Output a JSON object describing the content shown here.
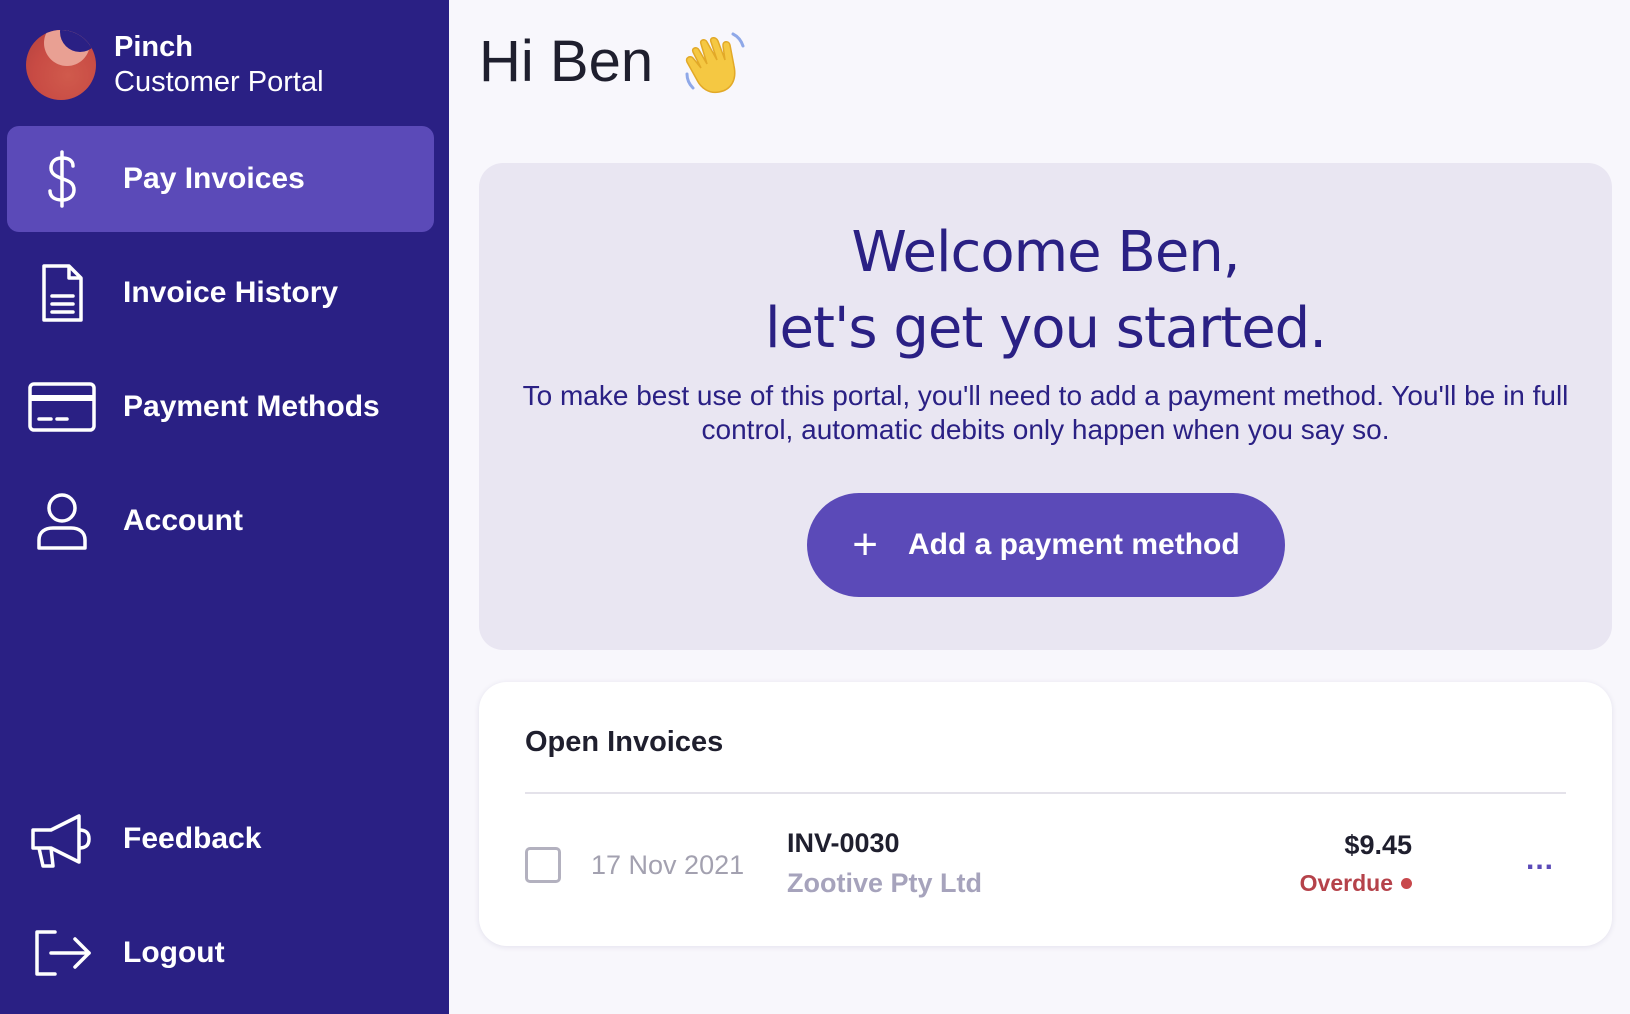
{
  "brand": {
    "name": "Pinch",
    "subtitle": "Customer Portal"
  },
  "sidebar": {
    "items": [
      {
        "label": "Pay Invoices",
        "icon": "dollar-icon",
        "active": true
      },
      {
        "label": "Invoice History",
        "icon": "document-icon",
        "active": false
      },
      {
        "label": "Payment Methods",
        "icon": "credit-card-icon",
        "active": false
      },
      {
        "label": "Account",
        "icon": "user-icon",
        "active": false
      }
    ],
    "bottom_items": [
      {
        "label": "Feedback",
        "icon": "megaphone-icon"
      },
      {
        "label": "Logout",
        "icon": "logout-icon"
      }
    ]
  },
  "main": {
    "greeting": "Hi Ben",
    "greeting_icon": "waving-hand-icon",
    "welcome": {
      "title_line1": "Welcome Ben,",
      "title_line2": "let's get you started.",
      "body": "To make best use of this portal, you'll need to add a payment method. You'll be in full control, automatic debits only happen when you say so.",
      "button_icon": "plus-icon",
      "button_label": "Add a payment method"
    },
    "open_invoices": {
      "title": "Open Invoices",
      "rows": [
        {
          "date": "17 Nov 2021",
          "number": "INV-0030",
          "company": "Zootive Pty Ltd",
          "amount": "$9.45",
          "status": "Overdue"
        }
      ],
      "more_label": "..."
    }
  },
  "colors": {
    "sidebar_bg": "#2a2084",
    "accent": "#5b4ab8",
    "welcome_card_bg": "#e9e6f2",
    "overdue": "#b5424a"
  }
}
